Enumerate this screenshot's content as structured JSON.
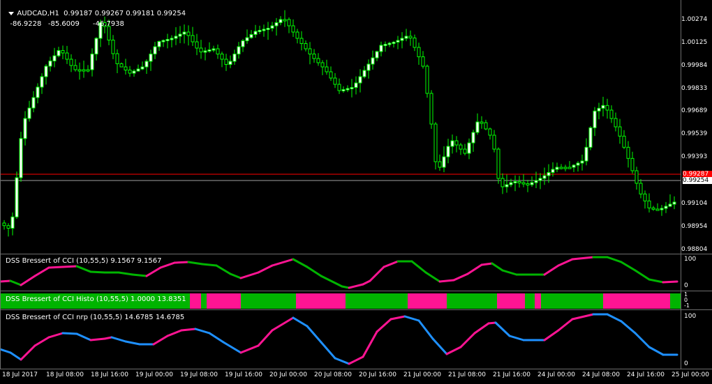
{
  "chart": {
    "symbol_timeframe": "AUDCAD,H1",
    "ohlc": "0.99187 0.99267 0.99181 0.99254",
    "sub_values": [
      "-86.9228",
      "-85.6009",
      "-46.7938"
    ],
    "price_ticks": [
      "1.00274",
      "1.00125",
      "0.99984",
      "0.99833",
      "0.99689",
      "0.99539",
      "0.99393",
      "0.99104",
      "0.98954",
      "0.98804"
    ],
    "bid_label": "0.99254",
    "ask_label": "0.99287",
    "bid_color": "#a0a0a0",
    "ask_color": "#ff0000",
    "candle_bull_color": "#00ff00",
    "candle_bear_color": "#ffffff"
  },
  "indicators": [
    {
      "title": "DSS Bressert of CCI (10,55,5) 9.1567 9.1567",
      "levels": [
        "100",
        "0"
      ]
    },
    {
      "title": "DSS Bressert of CCI Histo (10,55,5) 1.0000 13.8351",
      "levels": [
        "1",
        "0",
        "-1"
      ]
    },
    {
      "title": "DSS Bressert of CCI nrp (10,55,5) 14.6785 14.6785",
      "levels": [
        "100",
        "0"
      ]
    }
  ],
  "colors": {
    "up": "#00b400",
    "down": "#ff1493",
    "nrp_up": "#1e90ff",
    "nrp_down": "#ff1493"
  },
  "time_axis": [
    "18 Jul 2017",
    "18 Jul 08:00",
    "18 Jul 16:00",
    "19 Jul 00:00",
    "19 Jul 08:00",
    "19 Jul 16:00",
    "20 Jul 00:00",
    "20 Jul 08:00",
    "20 Jul 16:00",
    "21 Jul 00:00",
    "21 Jul 08:00",
    "21 Jul 16:00",
    "24 Jul 00:00",
    "24 Jul 08:00",
    "24 Jul 16:00",
    "25 Jul 00:00"
  ]
}
